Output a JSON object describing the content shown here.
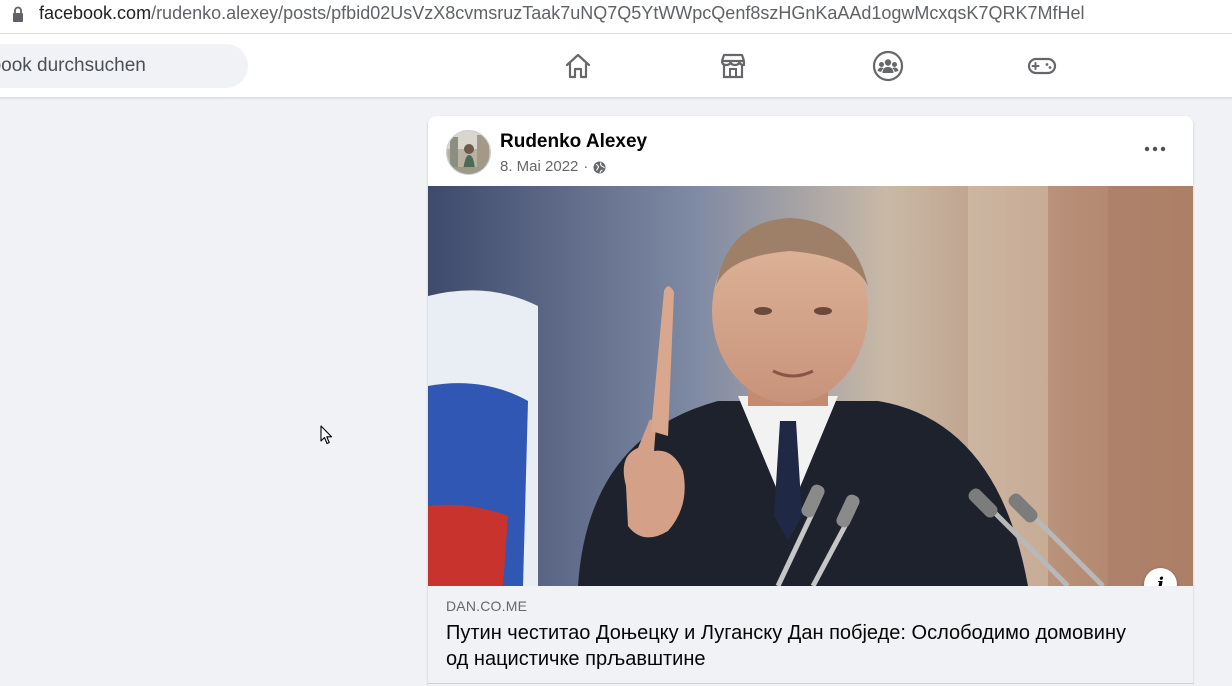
{
  "browser": {
    "url_domain": "facebook.com",
    "url_path": "/rudenko.alexey/posts/pfbid02UsVzX8cvmsruzTaak7uNQ7Q5YtWWpcQenf8szHGnKaAAd1ogwMcxqsK7QRK7MfHel"
  },
  "topnav": {
    "search_placeholder": "ebook durchsuchen",
    "tabs": [
      {
        "icon": "home-icon"
      },
      {
        "icon": "marketplace-icon"
      },
      {
        "icon": "groups-icon"
      },
      {
        "icon": "gaming-icon"
      }
    ]
  },
  "post": {
    "author": "Rudenko Alexey",
    "date": "8. Mai 2022",
    "separator": "·",
    "privacy_icon": "globe-icon",
    "link": {
      "domain": "DAN.CO.ME",
      "headline": "Путин честитао Доњецку и Луганску Дан побједе: Ослободимо домовину од нацистичке прљавштине"
    }
  },
  "colors": {
    "page_bg": "#f0f2f5",
    "card_bg": "#ffffff",
    "text_primary": "#050505",
    "text_secondary": "#65676b",
    "icon_gray": "#65676b"
  }
}
